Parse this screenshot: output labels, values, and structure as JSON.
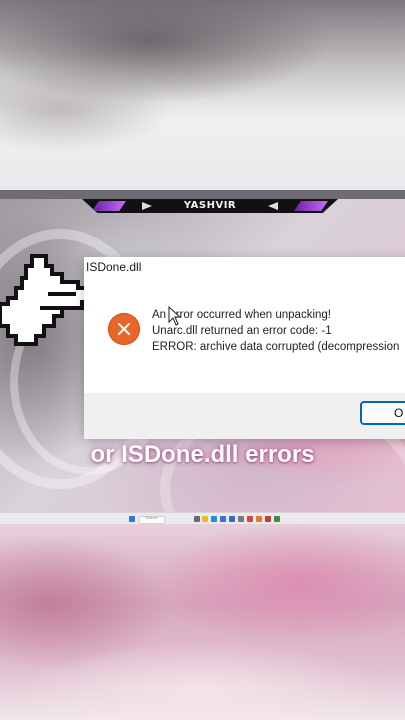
{
  "banner": {
    "name": "YASHVIR"
  },
  "dialog": {
    "title": "ISDone.dll",
    "messages": [
      "An error occurred when unpacking!",
      "Unarc.dll returned an error code: -1",
      "ERROR: archive data corrupted (decompression"
    ],
    "ok_label": "O"
  },
  "caption": "or ISDone.dll errors",
  "taskbar": {
    "search_placeholder": "Search",
    "icons": [
      "start-icon",
      "search-box",
      "file-explorer-icon",
      "edge-icon",
      "store-icon",
      "mail-icon",
      "settings-icon",
      "chrome-icon",
      "app-icon"
    ]
  },
  "colors": {
    "error_icon": "#e8662a",
    "ok_border": "#0067c0",
    "banner_accent": "#b44cff",
    "caption_glow": "#b42878"
  }
}
